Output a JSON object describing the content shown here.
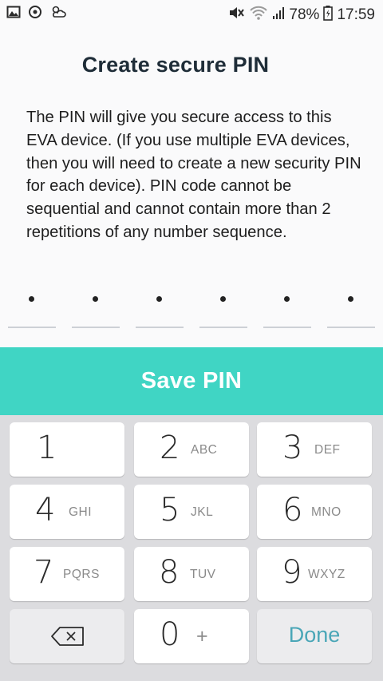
{
  "status_bar": {
    "left_icons": [
      "image-icon",
      "sync-icon",
      "weather-icon"
    ],
    "right_icons": [
      "mute-icon",
      "wifi-icon",
      "signal-icon",
      "battery-icon"
    ],
    "battery": "78%",
    "time": "17:59"
  },
  "screen": {
    "title": "Create secure PIN",
    "description": "The PIN will give you secure access to this EVA device. (If you use multiple EVA devices, then you will need to create a new security PIN for each device). PIN code cannot be sequential and cannot contain more than 2 repetitions of any number sequence.",
    "pin_length": 6,
    "pin_filled": 6,
    "save_label": "Save PIN"
  },
  "keypad": {
    "keys": [
      {
        "digit": "1",
        "letters": ""
      },
      {
        "digit": "2",
        "letters": "ABC"
      },
      {
        "digit": "3",
        "letters": "DEF"
      },
      {
        "digit": "4",
        "letters": "GHI"
      },
      {
        "digit": "5",
        "letters": "JKL"
      },
      {
        "digit": "6",
        "letters": "MNO"
      },
      {
        "digit": "7",
        "letters": "PQRS"
      },
      {
        "digit": "8",
        "letters": "TUV"
      },
      {
        "digit": "9",
        "letters": "WXYZ"
      },
      {
        "digit": "0",
        "letters": "+"
      }
    ],
    "done_label": "Done"
  },
  "colors": {
    "accent": "#40d5c4",
    "done": "#4aa6b7",
    "title": "#1f2d38"
  }
}
